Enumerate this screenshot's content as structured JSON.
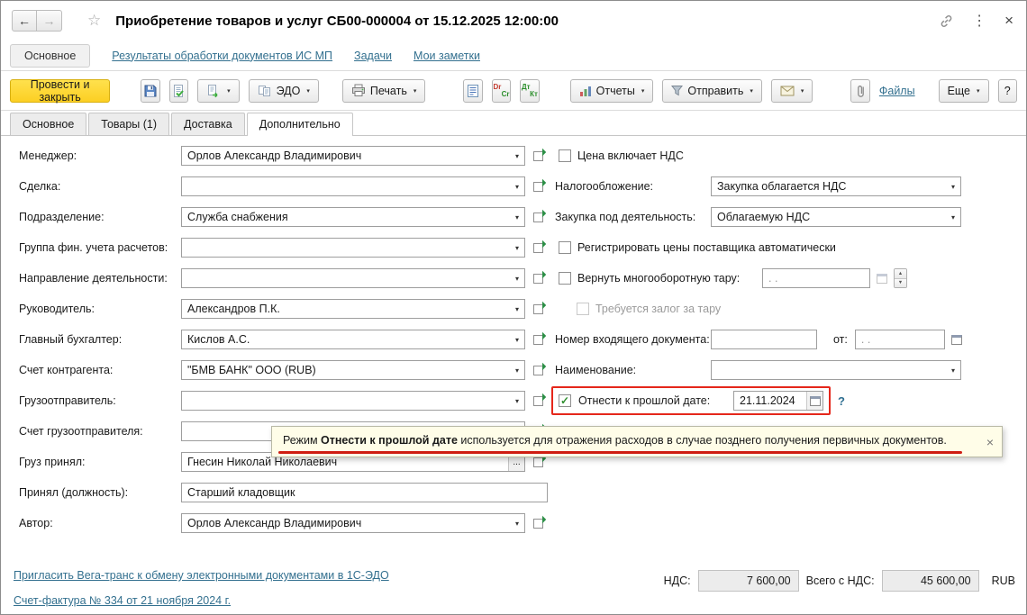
{
  "icons": {
    "back": "←",
    "forward": "→",
    "star": "☆",
    "kebab": "⋮",
    "close": "×",
    "caret": "▾",
    "ellipsis": "...",
    "spin_up": "▲",
    "spin_down": "▼"
  },
  "window": {
    "title": "Приобретение товаров и услуг СБ00-000004 от 15.12.2025 12:00:00"
  },
  "nav": {
    "main": "Основное",
    "links": [
      "Результаты обработки документов ИС МП",
      "Задачи",
      "Мои заметки"
    ]
  },
  "toolbar": {
    "post_and_close": "Провести и закрыть",
    "edo": "ЭДО",
    "print": "Печать",
    "reports": "Отчеты",
    "send": "Отправить",
    "files": "Файлы",
    "more": "Еще",
    "help": "?",
    "drcr": {
      "dr": "Dr",
      "cr": "Cr"
    },
    "dtkt": {
      "dt": "Дт",
      "kt": "Кт"
    }
  },
  "tabs": {
    "osnovnoe": "Основное",
    "tovary": "Товары (1)",
    "dostavka": "Доставка",
    "dopolnitelno": "Дополнительно"
  },
  "form": {
    "left": [
      {
        "label": "Менеджер:",
        "value": "Орлов Александр Владимирович"
      },
      {
        "label": "Сделка:",
        "value": ""
      },
      {
        "label": "Подразделение:",
        "value": "Служба снабжения"
      },
      {
        "label": "Группа фин. учета расчетов:",
        "value": ""
      },
      {
        "label": "Направление деятельности:",
        "value": ""
      },
      {
        "label": "Руководитель:",
        "value": "Александров П.К."
      },
      {
        "label": "Главный бухгалтер:",
        "value": "Кислов А.С."
      },
      {
        "label": "Счет контрагента:",
        "value": "\"БМВ БАНК\" ООО (RUB)"
      },
      {
        "label": "Грузоотправитель:",
        "value": ""
      },
      {
        "label": "Счет грузоотправителя:",
        "value": ""
      },
      {
        "label": "Груз принял:",
        "value": "Гнесин Николай Николаевич"
      },
      {
        "label": "Принял (должность):",
        "value": "Старший кладовщик"
      },
      {
        "label": "Автор:",
        "value": "Орлов Александр Владимирович"
      }
    ],
    "right": {
      "price_includes_vat": "Цена включает НДС",
      "taxation_label": "Налогообложение:",
      "taxation_value": "Закупка облагается НДС",
      "activity_label": "Закупка под деятельность:",
      "activity_value": "Облагаемую НДС",
      "register_prices": "Регистрировать цены поставщика автоматически",
      "return_tare": "Вернуть многооборотную тару:",
      "date_mask": ".  .",
      "tare_deposit": "Требуется залог за тару",
      "incoming_number_label": "Номер входящего документа:",
      "incoming_number_value": "",
      "from_label": "от:",
      "name_label": "Наименование:",
      "name_value": "",
      "past_date_label": "Отнести к прошлой дате:",
      "past_date_value": "21.11.2024",
      "help": "?"
    }
  },
  "tooltip": {
    "prefix": "Режим ",
    "bold": "Отнести к прошлой дате",
    "suffix": " используется для отражения расходов в случае позднего получения первичных документов."
  },
  "footer": {
    "invite_link": "Пригласить Вега-транс к обмену электронными документами в 1С-ЭДО",
    "invoice_link": "Счет-фактура № 334 от 21 ноября 2024 г.",
    "vat_label": "НДС:",
    "vat_value": "7 600,00",
    "total_label": "Всего с НДС:",
    "total_value": "45 600,00",
    "currency": "RUB"
  }
}
